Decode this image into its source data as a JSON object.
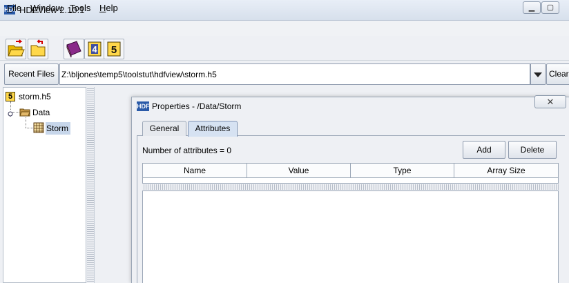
{
  "window": {
    "title": "HDFView 2.10.1",
    "logo_text": "HDF"
  },
  "menu": [
    {
      "label": "File",
      "mnemonic": "F",
      "rest": "ile"
    },
    {
      "label": "Window",
      "mnemonic": "W",
      "rest": "indow"
    },
    {
      "label": "Tools",
      "mnemonic": "T",
      "rest": "ools"
    },
    {
      "label": "Help",
      "mnemonic": "H",
      "rest": "elp"
    }
  ],
  "toolbar": {
    "buttons": [
      {
        "icon": "open-folder-icon"
      },
      {
        "icon": "close-folder-icon"
      },
      {
        "icon": "users-guide-book-icon"
      },
      {
        "icon": "hdf4-library-icon",
        "text": "4"
      },
      {
        "icon": "hdf5-library-icon",
        "text": "5"
      }
    ]
  },
  "recent": {
    "button_label": "Recent Files",
    "path_value": "Z:\\bljones\\temp5\\toolstut\\hdfview\\storm.h5",
    "clear_label": "Clear"
  },
  "tree": {
    "root": {
      "label": "storm.h5",
      "badge": "5"
    },
    "group": {
      "label": "Data"
    },
    "dataset": {
      "label": "Storm"
    }
  },
  "dialog": {
    "title": "Properties - /Data/Storm",
    "logo_text": "HDF",
    "close_glyph": "✕",
    "tabs": [
      {
        "label": "General",
        "active": false
      },
      {
        "label": "Attributes",
        "active": true
      }
    ],
    "attr_count_label": "Number of attributes = 0",
    "add_label": "Add",
    "delete_label": "Delete",
    "columns": [
      "Name",
      "Value",
      "Type",
      "Array Size"
    ]
  },
  "colors": {
    "selection": "#c7d6ea",
    "accent": "#2a5aa8"
  }
}
